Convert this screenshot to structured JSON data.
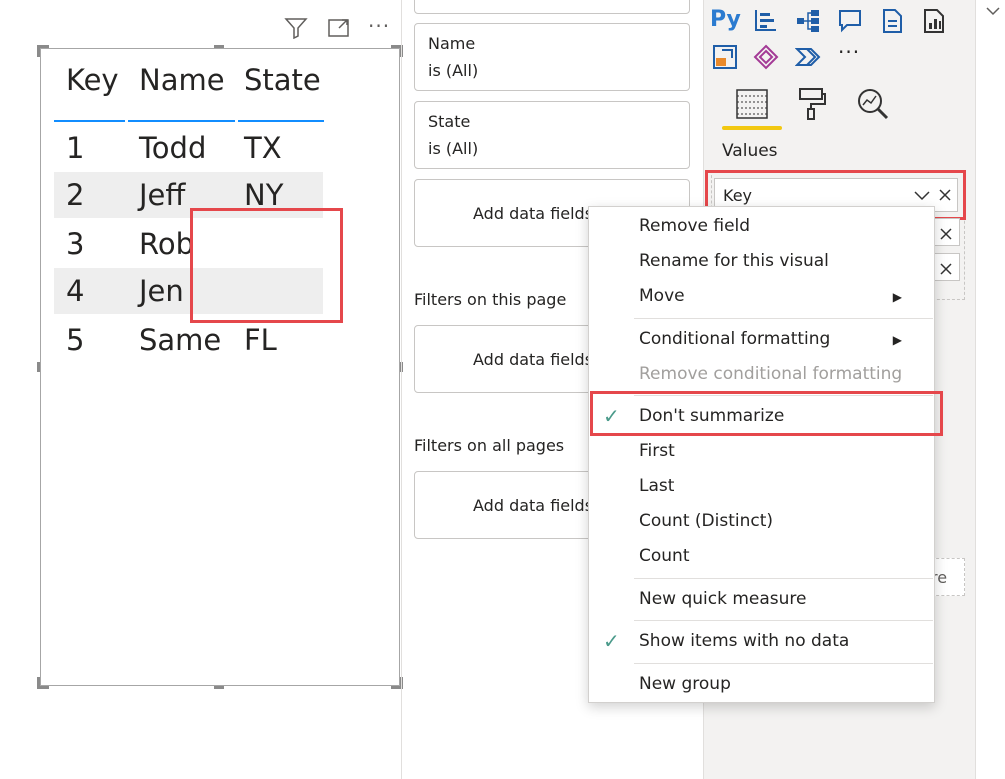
{
  "visual": {
    "header_icons": [
      "filter-icon",
      "focus-mode-icon",
      "more-options-icon"
    ],
    "more_glyph": "···",
    "table": {
      "columns": [
        "Key",
        "Name",
        "State"
      ],
      "rows": [
        [
          "1",
          "Todd",
          "TX"
        ],
        [
          "2",
          "Jeff",
          "NY"
        ],
        [
          "3",
          "Rob",
          ""
        ],
        [
          "4",
          "Jen",
          ""
        ],
        [
          "5",
          "Same",
          "FL"
        ]
      ]
    }
  },
  "filters": {
    "name_filter": {
      "field": "Name",
      "value": "is (All)"
    },
    "state_filter": {
      "field": "State",
      "value": "is (All)"
    },
    "add_data_fields": "Add data fields here",
    "this_page_title": "Filters on this page",
    "all_pages_title": "Filters on all pages"
  },
  "visualizations": {
    "python_icon_text": "Py",
    "more_glyph": "···",
    "tabs": [
      "fields-icon",
      "format-icon",
      "analytics-icon"
    ],
    "values_label": "Values",
    "value_fields": [
      "Key"
    ],
    "drop_label_fragment": "re",
    "accent_color": "#f2c811"
  },
  "context_menu": {
    "items": [
      {
        "label": "Remove field"
      },
      {
        "label": "Rename for this visual"
      },
      {
        "label": "Move",
        "submenu": true
      },
      {
        "label": "Conditional formatting",
        "submenu": true
      },
      {
        "label": "Remove conditional formatting",
        "disabled": true
      },
      {
        "label": "Don't summarize",
        "checked": true
      },
      {
        "label": "First"
      },
      {
        "label": "Last"
      },
      {
        "label": "Count (Distinct)"
      },
      {
        "label": "Count"
      },
      {
        "label": "New quick measure"
      },
      {
        "label": "Show items with no data",
        "checked": true
      },
      {
        "label": "New group"
      }
    ]
  },
  "highlight_color": "#e5474b"
}
